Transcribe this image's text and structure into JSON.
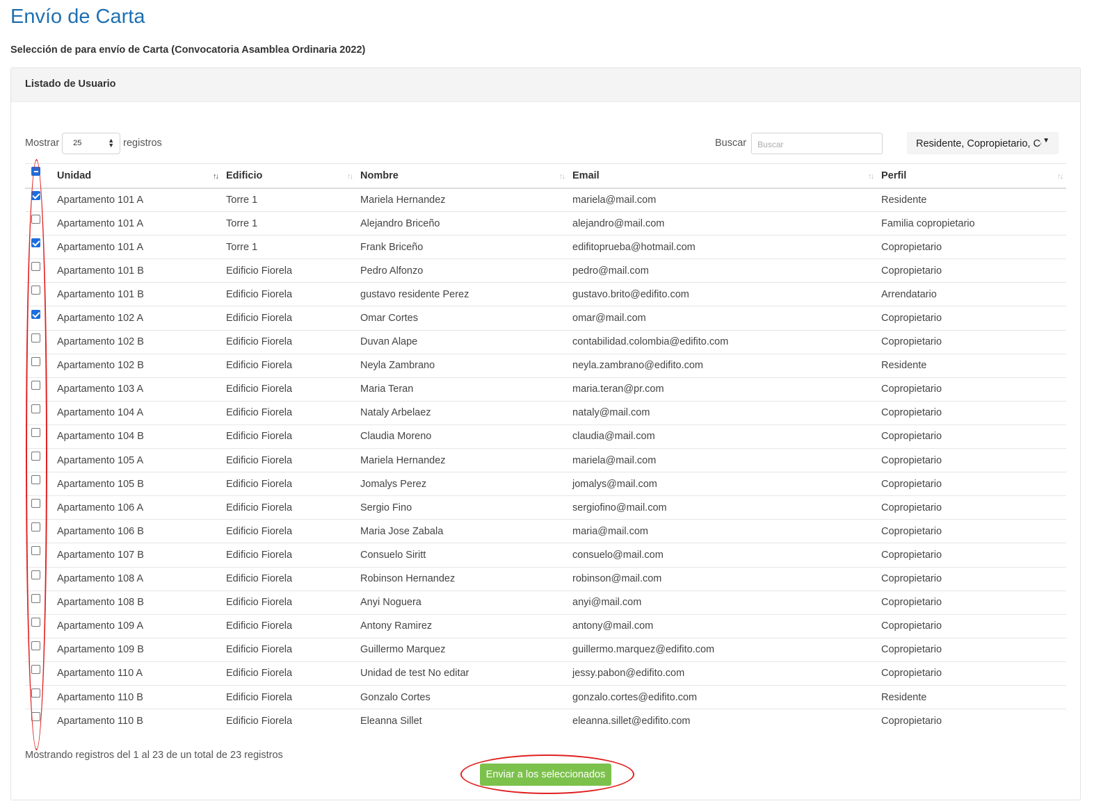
{
  "page": {
    "title": "Envío de Carta",
    "subtitle": "Selección de para envío de Carta (Convocatoria Asamblea Ordinaria 2022)"
  },
  "card": {
    "header": "Listado de Usuario",
    "length": {
      "prefix": "Mostrar",
      "value": "25",
      "suffix": "registros"
    },
    "search": {
      "label": "Buscar",
      "placeholder": "Buscar"
    },
    "filter": {
      "value": "Residente, Copropietario, Có"
    },
    "columns": [
      "Unidad",
      "Edificio",
      "Nombre",
      "Email",
      "Perfil"
    ],
    "header_checkbox": "indeterminate",
    "sorted_column": "Unidad",
    "rows": [
      {
        "checked": true,
        "unidad": "Apartamento 101 A",
        "edificio": "Torre 1",
        "nombre": "Mariela Hernandez",
        "email": "mariela@mail.com",
        "perfil": "Residente"
      },
      {
        "checked": false,
        "unidad": "Apartamento 101 A",
        "edificio": "Torre 1",
        "nombre": "Alejandro Briceño",
        "email": "alejandro@mail.com",
        "perfil": "Familia copropietario"
      },
      {
        "checked": true,
        "unidad": "Apartamento 101 A",
        "edificio": "Torre 1",
        "nombre": "Frank Briceño",
        "email": "edifitoprueba@hotmail.com",
        "perfil": "Copropietario"
      },
      {
        "checked": false,
        "unidad": "Apartamento 101 B",
        "edificio": "Edificio Fiorela",
        "nombre": "Pedro Alfonzo",
        "email": "pedro@mail.com",
        "perfil": "Copropietario"
      },
      {
        "checked": false,
        "unidad": "Apartamento 101 B",
        "edificio": "Edificio Fiorela",
        "nombre": "gustavo residente Perez",
        "email": "gustavo.brito@edifito.com",
        "perfil": "Arrendatario"
      },
      {
        "checked": true,
        "unidad": "Apartamento 102 A",
        "edificio": "Edificio Fiorela",
        "nombre": "Omar Cortes",
        "email": "omar@mail.com",
        "perfil": "Copropietario"
      },
      {
        "checked": false,
        "unidad": "Apartamento 102 B",
        "edificio": "Edificio Fiorela",
        "nombre": "Duvan Alape",
        "email": "contabilidad.colombia@edifito.com",
        "perfil": "Copropietario"
      },
      {
        "checked": false,
        "unidad": "Apartamento 102 B",
        "edificio": "Edificio Fiorela",
        "nombre": "Neyla Zambrano",
        "email": "neyla.zambrano@edifito.com",
        "perfil": "Residente"
      },
      {
        "checked": false,
        "unidad": "Apartamento 103 A",
        "edificio": "Edificio Fiorela",
        "nombre": "Maria Teran",
        "email": "maria.teran@pr.com",
        "perfil": "Copropietario"
      },
      {
        "checked": false,
        "unidad": "Apartamento 104 A",
        "edificio": "Edificio Fiorela",
        "nombre": "Nataly Arbelaez",
        "email": "nataly@mail.com",
        "perfil": "Copropietario"
      },
      {
        "checked": false,
        "unidad": "Apartamento 104 B",
        "edificio": "Edificio Fiorela",
        "nombre": "Claudia Moreno",
        "email": "claudia@mail.com",
        "perfil": "Copropietario"
      },
      {
        "checked": false,
        "unidad": "Apartamento 105 A",
        "edificio": "Edificio Fiorela",
        "nombre": "Mariela Hernandez",
        "email": "mariela@mail.com",
        "perfil": "Copropietario"
      },
      {
        "checked": false,
        "unidad": "Apartamento 105 B",
        "edificio": "Edificio Fiorela",
        "nombre": "Jomalys Perez",
        "email": "jomalys@mail.com",
        "perfil": "Copropietario"
      },
      {
        "checked": false,
        "unidad": "Apartamento 106 A",
        "edificio": "Edificio Fiorela",
        "nombre": "Sergio Fino",
        "email": "sergiofino@mail.com",
        "perfil": "Copropietario"
      },
      {
        "checked": false,
        "unidad": "Apartamento 106 B",
        "edificio": "Edificio Fiorela",
        "nombre": "Maria Jose Zabala",
        "email": "maria@mail.com",
        "perfil": "Copropietario"
      },
      {
        "checked": false,
        "unidad": "Apartamento 107 B",
        "edificio": "Edificio Fiorela",
        "nombre": "Consuelo Siritt",
        "email": "consuelo@mail.com",
        "perfil": "Copropietario"
      },
      {
        "checked": false,
        "unidad": "Apartamento 108 A",
        "edificio": "Edificio Fiorela",
        "nombre": "Robinson Hernandez",
        "email": "robinson@mail.com",
        "perfil": "Copropietario"
      },
      {
        "checked": false,
        "unidad": "Apartamento 108 B",
        "edificio": "Edificio Fiorela",
        "nombre": "Anyi Noguera",
        "email": "anyi@mail.com",
        "perfil": "Copropietario"
      },
      {
        "checked": false,
        "unidad": "Apartamento 109 A",
        "edificio": "Edificio Fiorela",
        "nombre": "Antony Ramirez",
        "email": "antony@mail.com",
        "perfil": "Copropietario"
      },
      {
        "checked": false,
        "unidad": "Apartamento 109 B",
        "edificio": "Edificio Fiorela",
        "nombre": "Guillermo Marquez",
        "email": "guillermo.marquez@edifito.com",
        "perfil": "Copropietario"
      },
      {
        "checked": false,
        "unidad": "Apartamento 110 A",
        "edificio": "Edificio Fiorela",
        "nombre": "Unidad de test No editar",
        "email": "jessy.pabon@edifito.com",
        "perfil": "Copropietario"
      },
      {
        "checked": false,
        "unidad": "Apartamento 110 B",
        "edificio": "Edificio Fiorela",
        "nombre": "Gonzalo Cortes",
        "email": "gonzalo.cortes@edifito.com",
        "perfil": "Residente"
      },
      {
        "checked": false,
        "unidad": "Apartamento 110 B",
        "edificio": "Edificio Fiorela",
        "nombre": "Eleanna Sillet",
        "email": "eleanna.sillet@edifito.com",
        "perfil": "Copropietario"
      }
    ],
    "info": "Mostrando registros del 1 al 23 de un total de 23 registros",
    "send_button": "Enviar a los seleccionados"
  },
  "colors": {
    "title": "#1f6fb2",
    "checkbox_checked": "#1a6ee0",
    "send_button": "#7cc14c",
    "annotation": "#e02020"
  }
}
